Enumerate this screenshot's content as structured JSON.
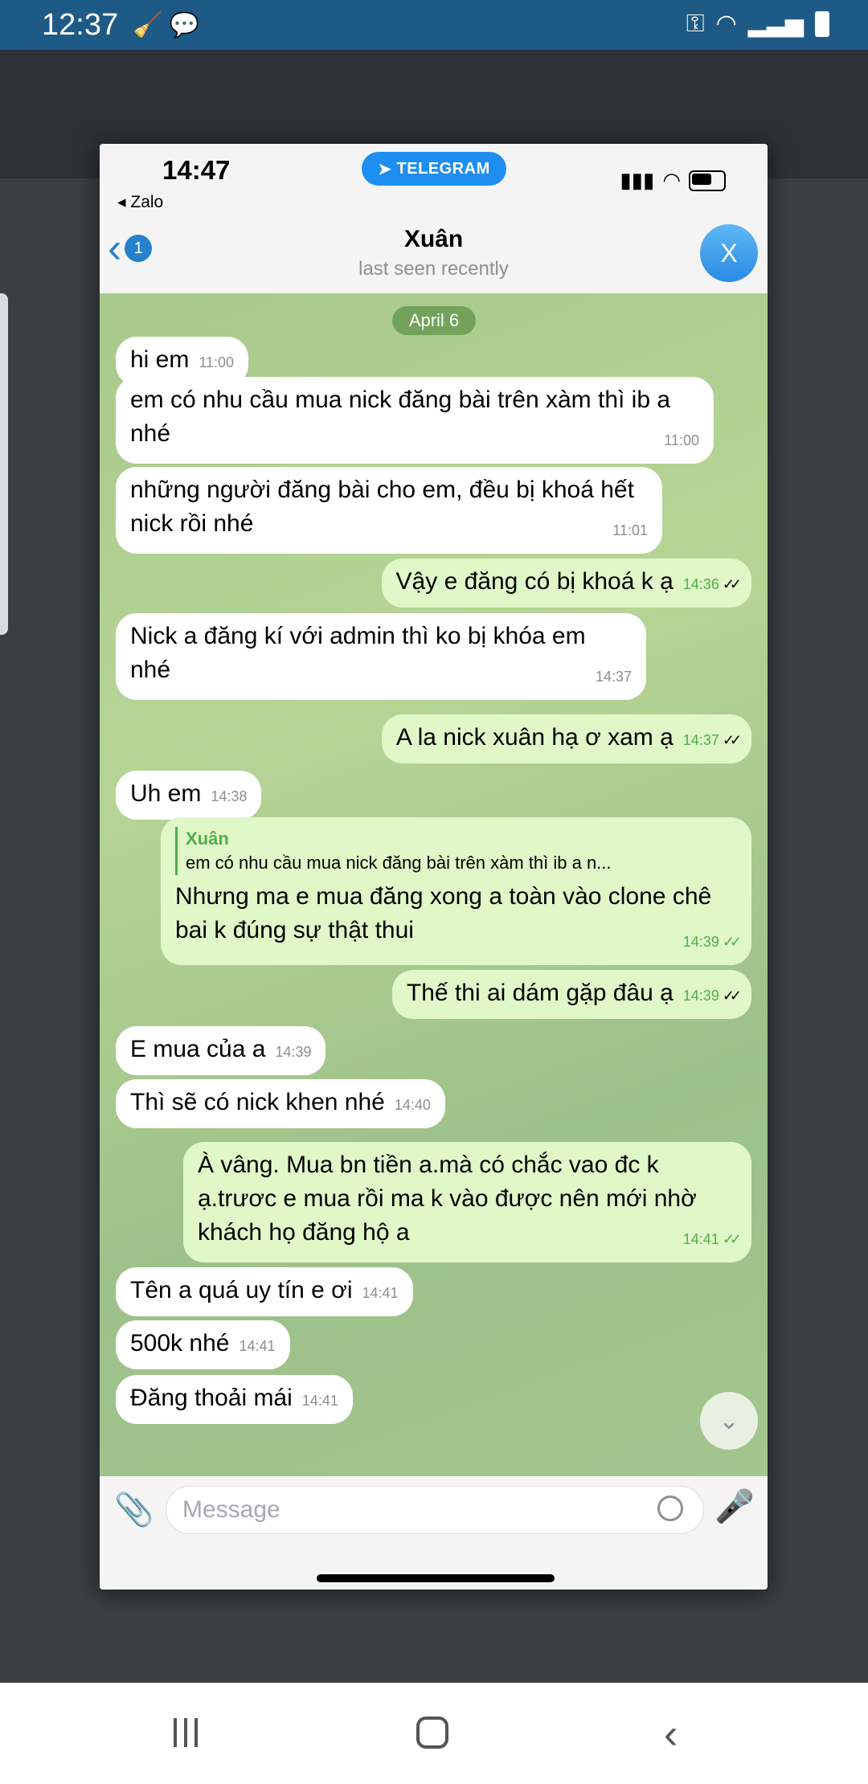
{
  "android_status": {
    "time": "12:37"
  },
  "ios_status": {
    "time": "14:47",
    "back_app": "◂ Zalo",
    "telegram_label": "TELEGRAM"
  },
  "header": {
    "back_badge": "1",
    "contact_name": "Xuân",
    "contact_status": "last seen recently",
    "avatar_glyph": "X"
  },
  "chat": {
    "date": "April 6",
    "messages": [
      {
        "dir": "in",
        "text": "hi em",
        "time": "11:00"
      },
      {
        "dir": "in",
        "text": "em có nhu cầu mua nick đăng bài trên xàm thì ib a nhé",
        "time": "11:00"
      },
      {
        "dir": "in",
        "text": "những người đăng bài cho em, đều bị khoá hết nick rồi nhé",
        "time": "11:01"
      },
      {
        "dir": "out",
        "text": "Vậy e đăng có bị khoá k ạ",
        "time": "14:36"
      },
      {
        "dir": "in",
        "text": "Nick a đăng kí với admin thì ko bị khóa em nhé",
        "time": "14:37"
      },
      {
        "dir": "out",
        "text": "A la nick xuân hạ ơ xam ạ",
        "time": "14:37"
      },
      {
        "dir": "in",
        "text": "Uh em",
        "time": "14:38"
      },
      {
        "dir": "out",
        "reply_name": "Xuân",
        "reply_text": "em có nhu cầu mua nick đăng bài trên xàm thì ib a n...",
        "text": "Nhưng ma e mua đăng xong a toàn vào clone chê bai k đúng sự thật thui",
        "time": "14:39"
      },
      {
        "dir": "out",
        "text": "Thế thi ai dám gặp đâu ạ",
        "time": "14:39"
      },
      {
        "dir": "in",
        "text": "E mua của a",
        "time": "14:39"
      },
      {
        "dir": "in",
        "text": "Thì sẽ có nick khen nhé",
        "time": "14:40"
      },
      {
        "dir": "out",
        "text": "À vâng. Mua bn tiền a.mà có chắc vao đc k ạ.trươc e mua rồi ma k vào được nên mới nhờ khách họ đăng hộ a",
        "time": "14:41"
      },
      {
        "dir": "in",
        "text": "Tên a quá uy tín e ơi",
        "time": "14:41"
      },
      {
        "dir": "in",
        "text": "500k nhé",
        "time": "14:41"
      },
      {
        "dir": "in",
        "text": "Đăng thoải mái",
        "time": "14:41"
      }
    ]
  },
  "input": {
    "placeholder": "Message"
  }
}
